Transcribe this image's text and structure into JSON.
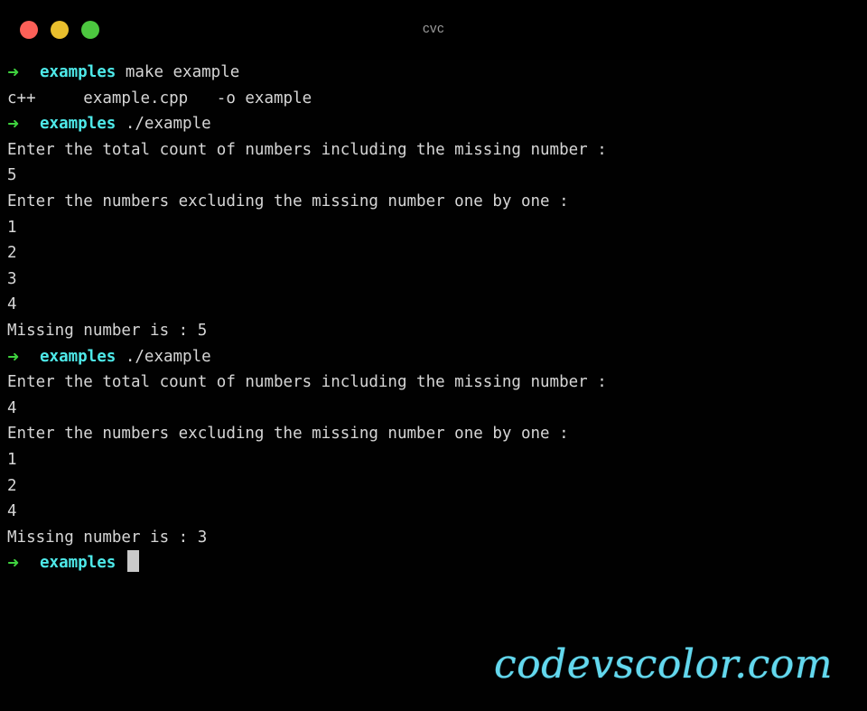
{
  "window": {
    "title": "cvc",
    "buttons": [
      {
        "name": "close-button",
        "color": "#fc6058"
      },
      {
        "name": "minimize-button",
        "color": "#e9bf2d"
      },
      {
        "name": "maximize-button",
        "color": "#4cc73f"
      }
    ]
  },
  "colors": {
    "background": "#010101",
    "foreground": "#d6d6d6",
    "prompt_arrow": "#3fd33f",
    "prompt_dir": "#4ee9e9",
    "cursor": "#c9c9c9",
    "watermark": "#63d8ee",
    "title": "#9a9a9a"
  },
  "terminal": {
    "prompt": {
      "arrow": "➜",
      "dir": "examples"
    },
    "lines": [
      {
        "type": "prompt",
        "command": "make example"
      },
      {
        "type": "output",
        "text": "c++     example.cpp   -o example"
      },
      {
        "type": "prompt",
        "command": "./example"
      },
      {
        "type": "output",
        "text": "Enter the total count of numbers including the missing number :"
      },
      {
        "type": "output",
        "text": "5"
      },
      {
        "type": "output",
        "text": "Enter the numbers excluding the missing number one by one :"
      },
      {
        "type": "output",
        "text": "1"
      },
      {
        "type": "output",
        "text": "2"
      },
      {
        "type": "output",
        "text": "3"
      },
      {
        "type": "output",
        "text": "4"
      },
      {
        "type": "output",
        "text": "Missing number is : 5"
      },
      {
        "type": "prompt",
        "command": "./example"
      },
      {
        "type": "output",
        "text": "Enter the total count of numbers including the missing number :"
      },
      {
        "type": "output",
        "text": "4"
      },
      {
        "type": "output",
        "text": "Enter the numbers excluding the missing number one by one :"
      },
      {
        "type": "output",
        "text": "1"
      },
      {
        "type": "output",
        "text": "2"
      },
      {
        "type": "output",
        "text": "4"
      },
      {
        "type": "output",
        "text": "Missing number is : 3"
      },
      {
        "type": "prompt-cursor",
        "command": ""
      }
    ]
  },
  "watermark": {
    "text": "codevscolor.com"
  }
}
